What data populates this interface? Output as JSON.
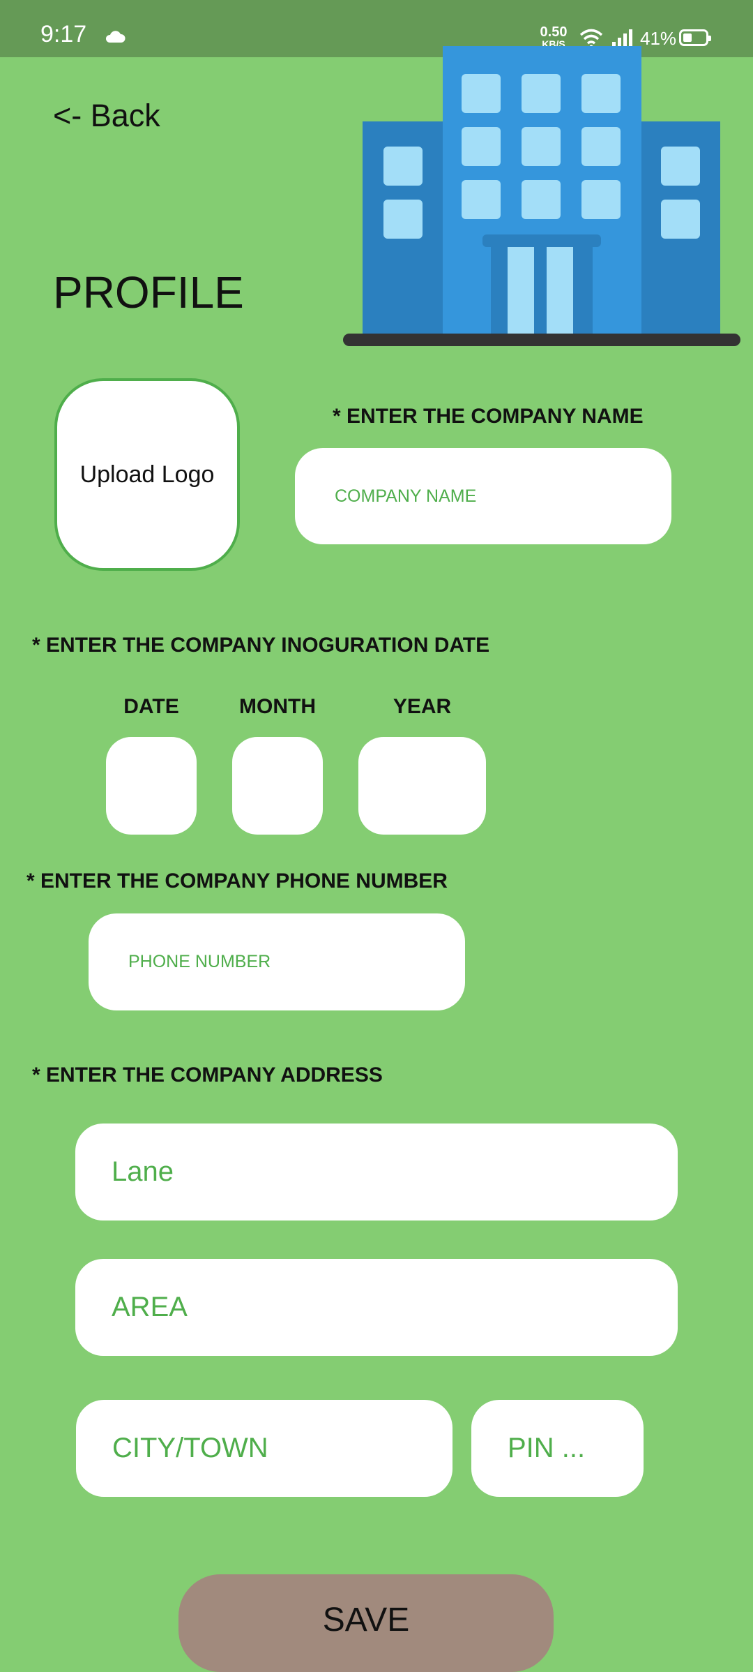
{
  "status_bar": {
    "time": "9:17",
    "net_speed_value": "0.50",
    "net_speed_unit": "KB/S",
    "battery": "41%",
    "icons": [
      "cloud-icon",
      "wifi-icon",
      "signal-icon",
      "battery-icon"
    ]
  },
  "header": {
    "back_label": "<- Back",
    "title": "PROFILE",
    "illustration": "building-icon"
  },
  "logo": {
    "label": "Upload Logo"
  },
  "company_name": {
    "label": "* ENTER THE COMPANY NAME",
    "placeholder": "COMPANY NAME"
  },
  "inauguration": {
    "label": "* ENTER THE COMPANY INOGURATION DATE",
    "date_label": "DATE",
    "month_label": "MONTH",
    "year_label": "YEAR"
  },
  "phone": {
    "label": "* ENTER THE COMPANY PHONE NUMBER",
    "placeholder": "PHONE NUMBER"
  },
  "address": {
    "label": "* ENTER THE COMPANY ADDRESS",
    "lane_placeholder": "Lane",
    "area_placeholder": "AREA",
    "city_placeholder": "CITY/TOWN",
    "pin_placeholder": "PIN ..."
  },
  "actions": {
    "save_label": "SAVE"
  },
  "colors": {
    "background": "#84cd72",
    "status_bar": "#659a56",
    "placeholder_text": "#4fae4b",
    "save_button": "#a18a7d",
    "building_blue": "#3596dc"
  }
}
